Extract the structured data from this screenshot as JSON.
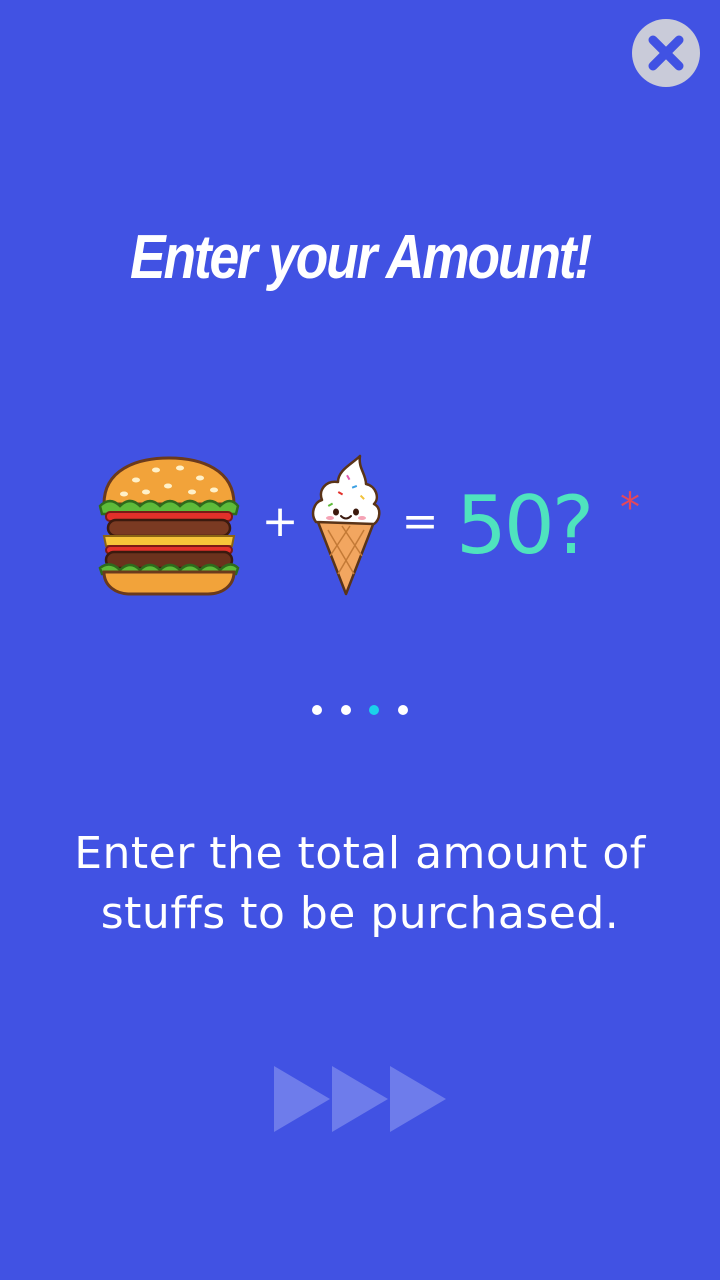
{
  "close_button": {
    "icon": "close-icon",
    "label": "Close"
  },
  "title": "Enter your Amount!",
  "equation": {
    "item1_icon": "burger-icon",
    "operator_plus": "+",
    "item2_icon": "ice-cream-icon",
    "operator_equals": "=",
    "amount": "50?",
    "asterisk": "*"
  },
  "pagination": {
    "total": 4,
    "active_index": 2
  },
  "description": "Enter the total amount of stuffs to be purchased.",
  "next_button": {
    "icon": "fast-forward-icon"
  },
  "colors": {
    "background": "#4152E3",
    "amount": "#4FE3BE",
    "asterisk": "#E4475A",
    "active_dot": "#1BD1EA",
    "close_button_bg": "#C9CBD9"
  }
}
